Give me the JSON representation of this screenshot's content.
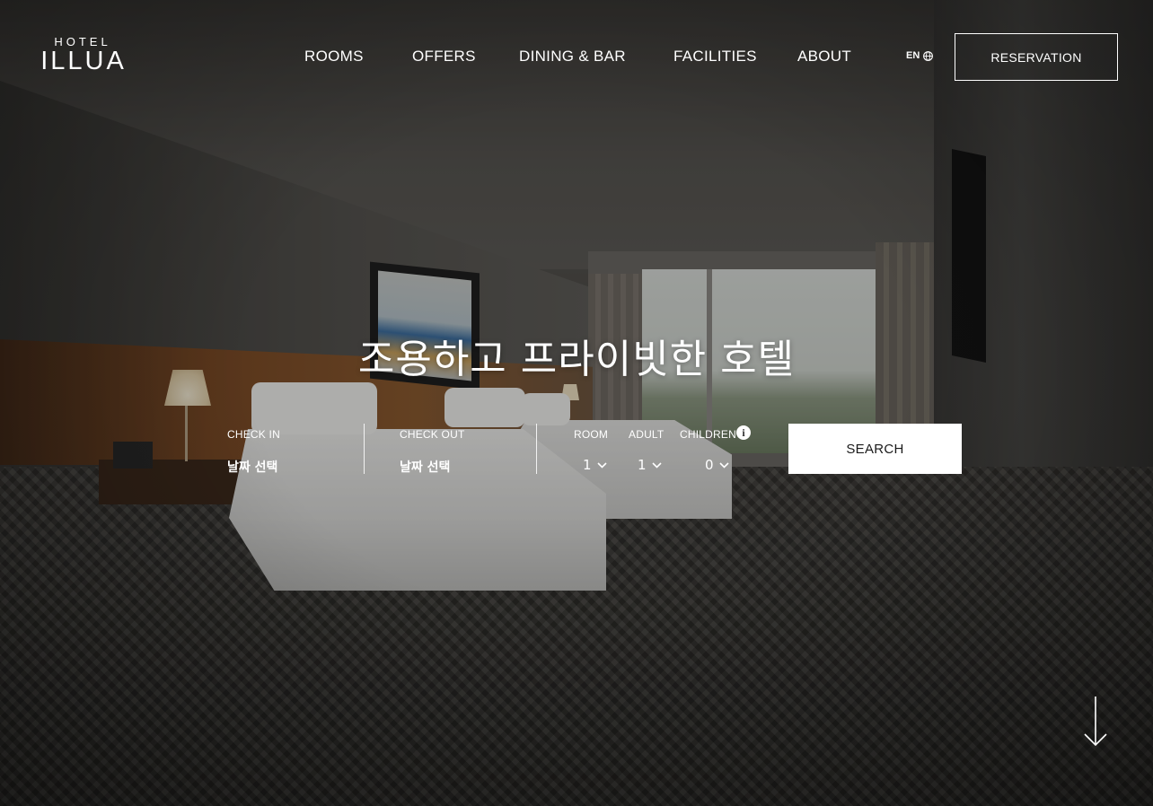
{
  "brand": {
    "logo_top": "HOTEL",
    "logo_main": "ILLUA"
  },
  "nav": {
    "items": [
      {
        "label": "ROOMS"
      },
      {
        "label": "OFFERS"
      },
      {
        "label": "DINING & BAR"
      },
      {
        "label": "FACILITIES"
      },
      {
        "label": "ABOUT"
      }
    ],
    "language": "EN",
    "language_icon": "globe-icon",
    "reservation_label": "RESERVATION"
  },
  "hero": {
    "headline": "조용하고 프라이빗한 호텔"
  },
  "booking": {
    "check_in": {
      "label": "CHECK IN",
      "value": "날짜 선택"
    },
    "check_out": {
      "label": "CHECK OUT",
      "value": "날짜 선택"
    },
    "room": {
      "label": "ROOM",
      "value": "1"
    },
    "adult": {
      "label": "ADULT",
      "value": "1"
    },
    "children": {
      "label": "CHILDREN",
      "value": "0",
      "info_icon": "info-icon"
    },
    "search_label": "SEARCH"
  },
  "scroll_indicator": {
    "icon": "arrow-down-icon"
  },
  "colors": {
    "text": "#ffffff",
    "button_bg": "#ffffff",
    "button_text": "#1a1a1a"
  }
}
